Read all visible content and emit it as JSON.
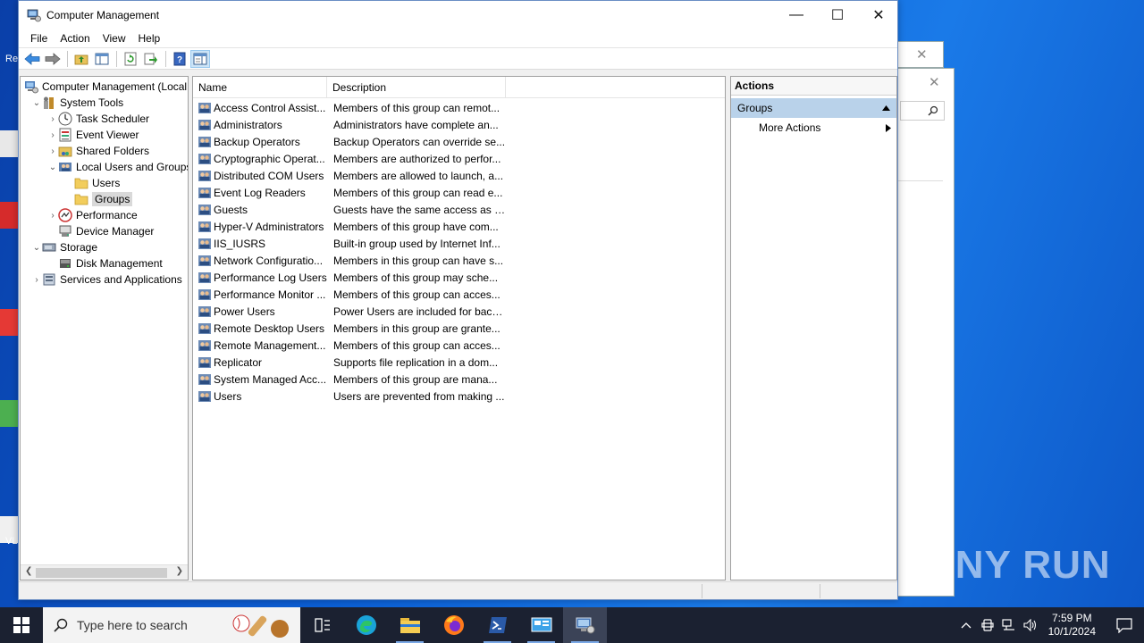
{
  "window": {
    "title": "Computer Management",
    "minimize": "—",
    "maximize": "☐",
    "close": "✕"
  },
  "menu": [
    "File",
    "Action",
    "View",
    "Help"
  ],
  "tree": {
    "items": [
      {
        "label": "Computer Management (Local",
        "level": 0,
        "expander": "",
        "icon": "computer-management-icon"
      },
      {
        "label": "System Tools",
        "level": 1,
        "expander": "expanded",
        "icon": "tools-icon"
      },
      {
        "label": "Task Scheduler",
        "level": 2,
        "expander": "collapsed",
        "icon": "clock-icon"
      },
      {
        "label": "Event Viewer",
        "level": 2,
        "expander": "collapsed",
        "icon": "event-viewer-icon"
      },
      {
        "label": "Shared Folders",
        "level": 2,
        "expander": "collapsed",
        "icon": "shared-folder-icon"
      },
      {
        "label": "Local Users and Groups",
        "level": 2,
        "expander": "expanded",
        "icon": "users-icon"
      },
      {
        "label": "Users",
        "level": 3,
        "expander": "",
        "icon": "folder-icon"
      },
      {
        "label": "Groups",
        "level": 3,
        "expander": "",
        "icon": "folder-icon",
        "selected": true
      },
      {
        "label": "Performance",
        "level": 2,
        "expander": "collapsed",
        "icon": "performance-icon"
      },
      {
        "label": "Device Manager",
        "level": 2,
        "expander": "",
        "icon": "device-manager-icon"
      },
      {
        "label": "Storage",
        "level": 1,
        "expander": "expanded",
        "icon": "storage-icon"
      },
      {
        "label": "Disk Management",
        "level": 2,
        "expander": "",
        "icon": "disk-icon"
      },
      {
        "label": "Services and Applications",
        "level": 1,
        "expander": "collapsed",
        "icon": "services-icon"
      }
    ]
  },
  "list": {
    "columns": [
      "Name",
      "Description"
    ],
    "rows": [
      {
        "name": "Access Control Assist...",
        "description": "Members of this group can remot..."
      },
      {
        "name": "Administrators",
        "description": "Administrators have complete an..."
      },
      {
        "name": "Backup Operators",
        "description": "Backup Operators can override se..."
      },
      {
        "name": "Cryptographic Operat...",
        "description": "Members are authorized to perfor..."
      },
      {
        "name": "Distributed COM Users",
        "description": "Members are allowed to launch, a..."
      },
      {
        "name": "Event Log Readers",
        "description": "Members of this group can read e..."
      },
      {
        "name": "Guests",
        "description": "Guests have the same access as m..."
      },
      {
        "name": "Hyper-V Administrators",
        "description": "Members of this group have com..."
      },
      {
        "name": "IIS_IUSRS",
        "description": "Built-in group used by Internet Inf..."
      },
      {
        "name": "Network Configuratio...",
        "description": "Members in this group can have s..."
      },
      {
        "name": "Performance Log Users",
        "description": "Members of this group may sche..."
      },
      {
        "name": "Performance Monitor ...",
        "description": "Members of this group can acces..."
      },
      {
        "name": "Power Users",
        "description": "Power Users are included for back..."
      },
      {
        "name": "Remote Desktop Users",
        "description": "Members in this group are grante..."
      },
      {
        "name": "Remote Management...",
        "description": "Members of this group can acces..."
      },
      {
        "name": "Replicator",
        "description": "Supports file replication in a dom..."
      },
      {
        "name": "System Managed Acc...",
        "description": "Members of this group are mana..."
      },
      {
        "name": "Users",
        "description": "Users are prevented from making ..."
      }
    ]
  },
  "actions": {
    "header": "Actions",
    "group": "Groups",
    "items": [
      "More Actions"
    ]
  },
  "taskbar": {
    "search_placeholder": "Type here to search",
    "time": "7:59 PM",
    "date": "10/1/2024"
  },
  "watermark": "ANY RUN"
}
